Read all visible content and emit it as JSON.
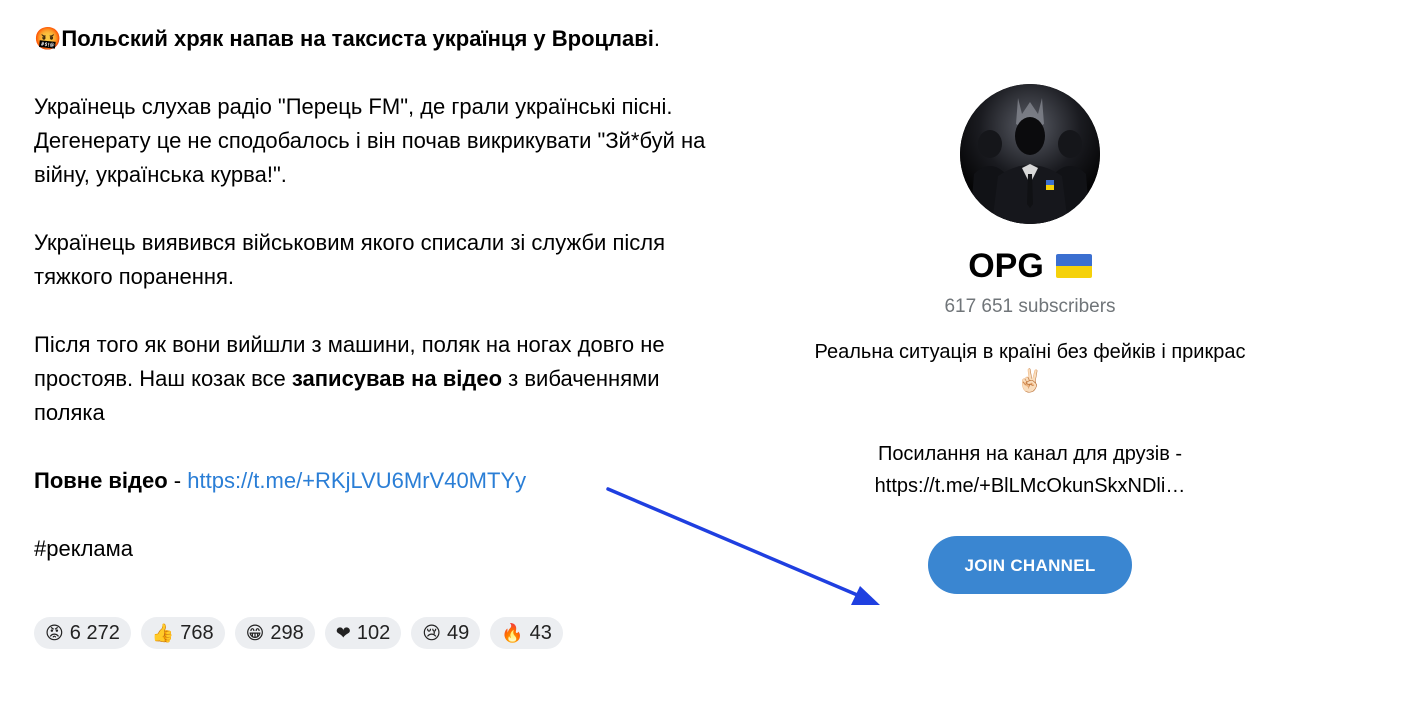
{
  "post": {
    "title_emoji": "🤬",
    "title": "Польский хряк напав на таксиста українця у Вроцлаві",
    "title_tail": ".",
    "p1": "Українець слухав радіо \"Перець FM\", де грали українські пісні. Дегенерату це не сподобалось і він почав викрикувати \"Зй*буй на війну, українська курва!\".",
    "p2": "Українець виявився військовим якого списали зі служби після тяжкого поранення.",
    "p3_a": "Після того як вони вийшли з машини, поляк на ногах довго не простояв. Наш козак все ",
    "p3_bold": "записував на відео",
    "p3_b": " з вибаченнями поляка",
    "video_label": "Повне відео",
    "video_sep": " - ",
    "video_link": "https://t.me/+RKjLVU6MrV40MTYy",
    "hashtag": "#реклама"
  },
  "reactions": [
    {
      "emoji": "😡",
      "count": "6 272"
    },
    {
      "emoji": "👍",
      "count": "768"
    },
    {
      "emoji": "😁",
      "count": "298"
    },
    {
      "emoji": "❤",
      "count": "102"
    },
    {
      "emoji": "😢",
      "count": "49"
    },
    {
      "emoji": "🔥",
      "count": "43"
    }
  ],
  "channel": {
    "name": "OPG",
    "flag_colors": [
      "#3b6fd0",
      "#f5d10a"
    ],
    "subscribers": "617 651 subscribers",
    "description": "Реальна ситуація в країні без фейків і прикрас",
    "description_emoji": "✌🏻",
    "link_label": "Посилання на канал для друзів -",
    "link_value": "https://t.me/+BlLMcOkunSkxNDli…",
    "join_label": "JOIN CHANNEL",
    "avatar_icon": "avatar-image"
  },
  "colors": {
    "link": "#2a7ed6",
    "button": "#3a86d1",
    "arrow": "#1f3fe0"
  }
}
